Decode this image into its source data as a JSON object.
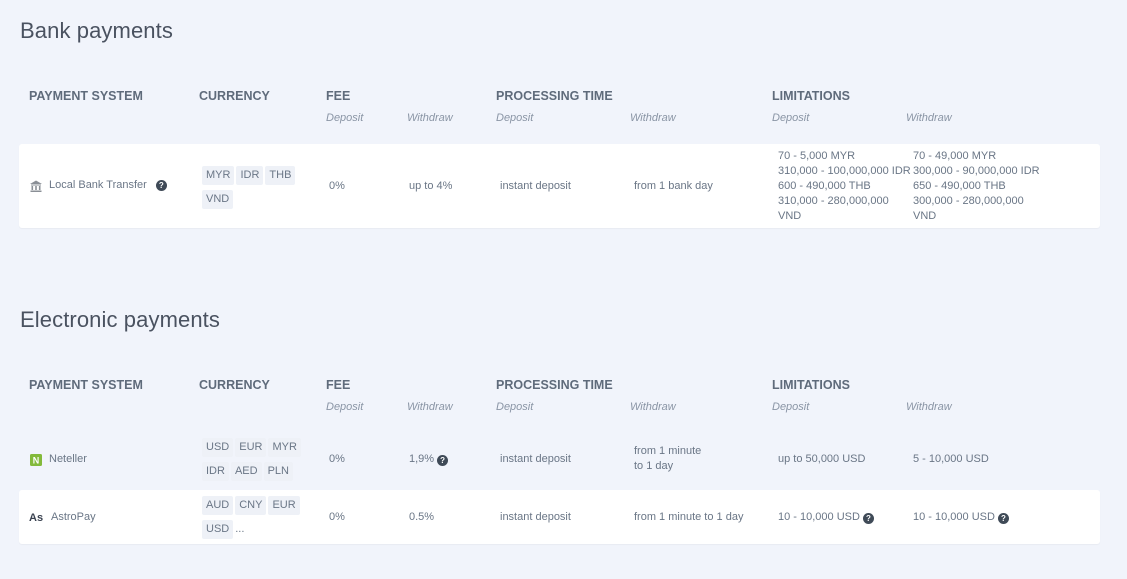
{
  "columns": {
    "payment_system": "PAYMENT SYSTEM",
    "currency": "CURRENCY",
    "fee": "FEE",
    "processing_time": "PROCESSING TIME",
    "limitations": "LIMITATIONS",
    "deposit": "Deposit",
    "withdraw": "Withdraw"
  },
  "bank": {
    "title": "Bank payments",
    "rows": [
      {
        "name": "Local Bank Transfer",
        "icon": "bank-icon",
        "currencies": [
          "MYR",
          "IDR",
          "THB",
          "VND"
        ],
        "fee_deposit": "0%",
        "fee_withdraw": "up to 4%",
        "time_deposit": "instant deposit",
        "time_withdraw": "from 1 bank day",
        "limit_deposit": [
          "70 - 5,000 MYR",
          "310,000 - 100,000,000 IDR",
          "600 - 490,000 THB",
          "310,000 - 280,000,000",
          "VND"
        ],
        "limit_withdraw": [
          "70 - 49,000 MYR",
          "300,000 - 90,000,000 IDR",
          "650 - 490,000 THB",
          "300,000 - 280,000,000",
          "VND"
        ]
      }
    ]
  },
  "electronic": {
    "title": "Electronic payments",
    "rows": [
      {
        "name": "Neteller",
        "icon": "neteller-icon",
        "currencies": [
          "USD",
          "EUR",
          "MYR",
          "IDR",
          "AED",
          "PLN"
        ],
        "fee_deposit": "0%",
        "fee_withdraw": "1,9%",
        "time_deposit": "instant deposit",
        "time_withdraw_1": "from 1 minute",
        "time_withdraw_2": "to 1 day",
        "limit_deposit": "up to 50,000 USD",
        "limit_withdraw": "5 - 10,000 USD"
      },
      {
        "name": "AstroPay",
        "icon": "astropay-icon",
        "icon_text": "As",
        "currencies": [
          "AUD",
          "CNY",
          "EUR",
          "USD"
        ],
        "more": "...",
        "fee_deposit": "0%",
        "fee_withdraw": "0.5%",
        "time_deposit": "instant deposit",
        "time_withdraw": "from 1 minute to 1 day",
        "limit_deposit": "10 - 10,000 USD",
        "limit_withdraw": "10 - 10,000 USD"
      }
    ]
  },
  "colors": {
    "background": "#f1f4fb",
    "card": "#ffffff",
    "chip": "#eef1f7",
    "neteller": "#83ba3b"
  }
}
